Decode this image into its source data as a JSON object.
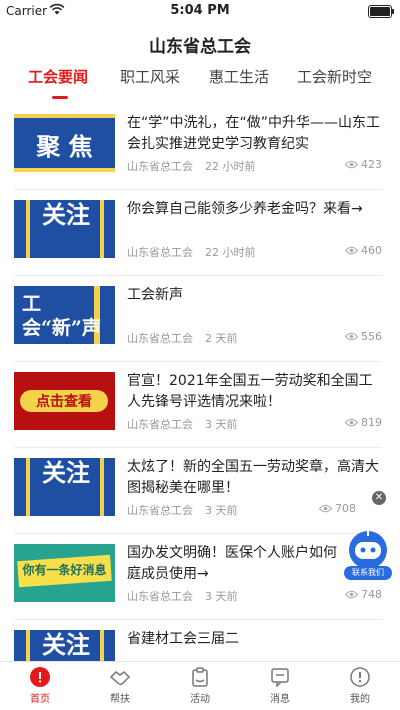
{
  "status_bar": {
    "carrier": "Carrier",
    "time": "5:04 PM"
  },
  "header": {
    "title": "山东省总工会"
  },
  "tabs": [
    {
      "label": "工会要闻",
      "active": true
    },
    {
      "label": "职工风采",
      "active": false
    },
    {
      "label": "惠工生活",
      "active": false
    },
    {
      "label": "工会新时空",
      "active": false
    }
  ],
  "articles": [
    {
      "title": "在“学”中洗礼，在“做”中升华——山东工会扎实推进党史学习教育纪实",
      "source": "山东省总工会",
      "time_ago": "22 小时前",
      "views": "423",
      "thumb_text": "聚 焦"
    },
    {
      "title": "你会算自己能领多少养老金吗？来看→",
      "source": "山东省总工会",
      "time_ago": "22 小时前",
      "views": "460",
      "thumb_text": "关注"
    },
    {
      "title": "工会新声",
      "source": "山东省总工会",
      "time_ago": "2 天前",
      "views": "556",
      "thumb_text": "工会“新”声"
    },
    {
      "title": "官宣！2021年全国五一劳动奖和全国工人先锋号评选情况来啦！",
      "source": "山东省总工会",
      "time_ago": "3 天前",
      "views": "819",
      "thumb_text": "点击查看"
    },
    {
      "title": "太炫了！新的全国五一劳动奖章，高清大图揭秘美在哪里！",
      "source": "山东省总工会",
      "time_ago": "3 天前",
      "views": "708",
      "thumb_text": "关注"
    },
    {
      "title": "国办发文明确！医保个人账户如何庭成员使用→",
      "source": "山东省总工会",
      "time_ago": "3 天前",
      "views": "748",
      "thumb_text": "你有一条好消息"
    },
    {
      "title": "省建材工会三届二",
      "source": "",
      "time_ago": "",
      "views": "",
      "thumb_text": "关注"
    }
  ],
  "floating_assistant": {
    "label": "联系我们"
  },
  "bottom_nav": [
    {
      "label": "首页",
      "icon": "home-icon",
      "active": true
    },
    {
      "label": "帮扶",
      "icon": "handshake-icon",
      "active": false
    },
    {
      "label": "活动",
      "icon": "clipboard-icon",
      "active": false
    },
    {
      "label": "消息",
      "icon": "message-icon",
      "active": false
    },
    {
      "label": "我的",
      "icon": "profile-icon",
      "active": false
    }
  ],
  "colors": {
    "accent": "#e11b1b",
    "thumb_blue": "#1e4fa3",
    "meta_gray": "#999999"
  }
}
